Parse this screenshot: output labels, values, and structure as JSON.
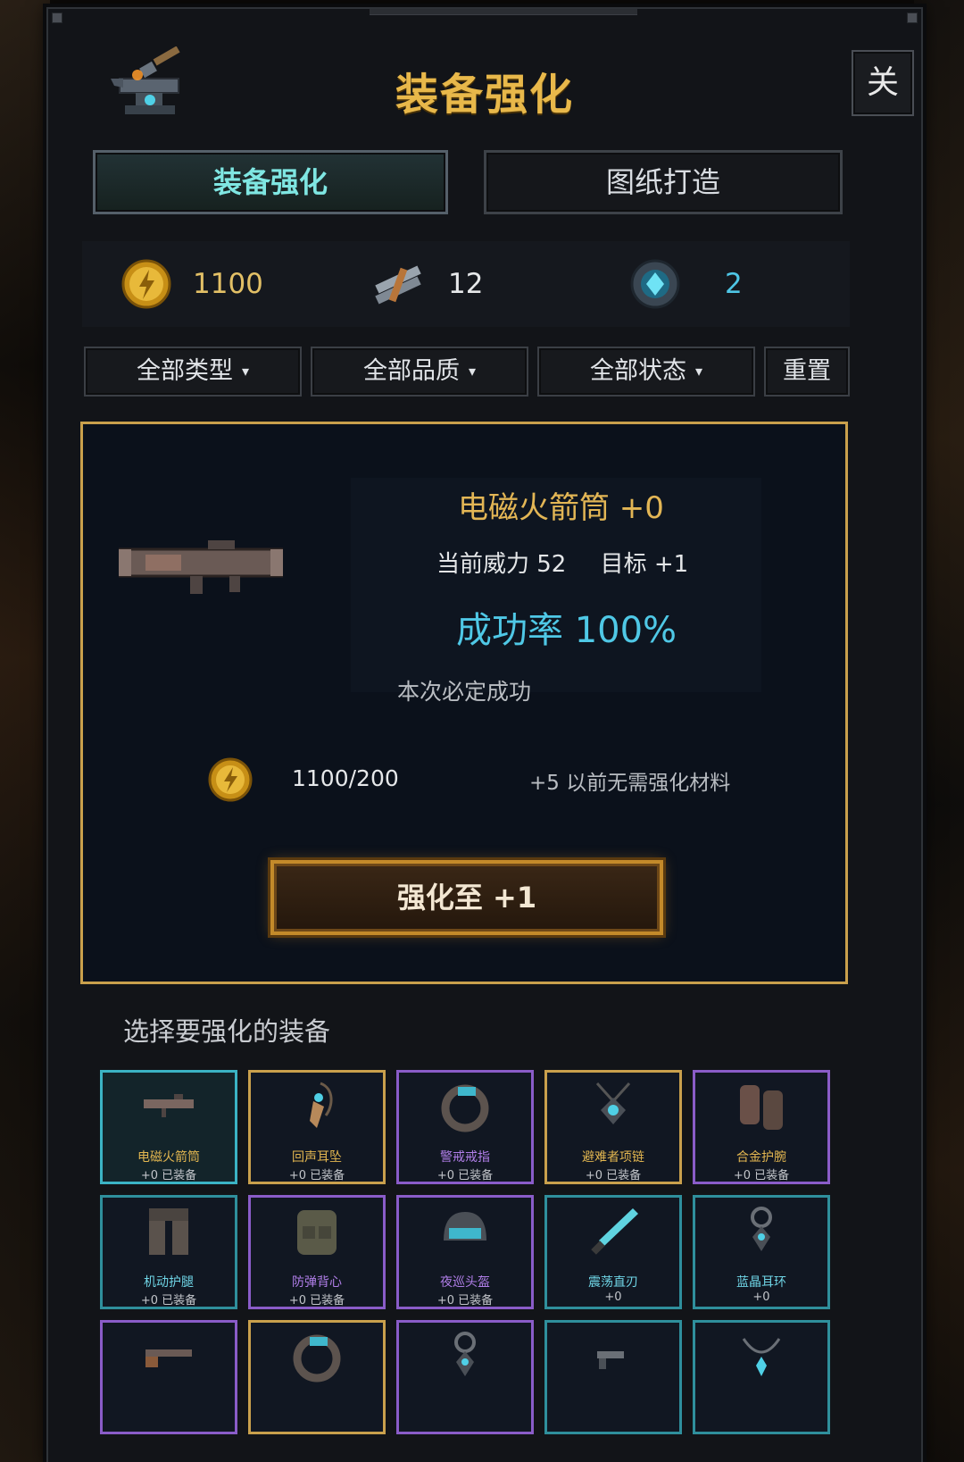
{
  "header": {
    "title": "装备强化",
    "close_label": "关"
  },
  "tabs": [
    {
      "label": "装备强化",
      "active": true
    },
    {
      "label": "图纸打造",
      "active": false
    }
  ],
  "resources": {
    "gold": "1100",
    "material": "12",
    "gem": "2"
  },
  "filters": {
    "type": "全部类型",
    "quality": "全部品质",
    "status": "全部状态",
    "reset": "重置",
    "caret": "▾"
  },
  "detail": {
    "name": "电磁火箭筒 +0",
    "power_label": "当前威力 52",
    "target_label": "目标 +1",
    "success_rate": "成功率 100%",
    "guarantee": "本次必定成功",
    "cost": "1100/200",
    "cost_note": "+5 以前无需强化材料",
    "upgrade_button": "强化至 +1"
  },
  "select_label": "选择要强化的装备",
  "equipment": [
    {
      "name": "电磁火箭筒",
      "status": "+0  已装备",
      "quality": "cyan-selected"
    },
    {
      "name": "回声耳坠",
      "status": "+0  已装备",
      "quality": "gold"
    },
    {
      "name": "警戒戒指",
      "status": "+0  已装备",
      "quality": "purple"
    },
    {
      "name": "避难者项链",
      "status": "+0  已装备",
      "quality": "gold"
    },
    {
      "name": "合金护腕",
      "status": "+0  已装备",
      "quality": "purple"
    },
    {
      "name": "机动护腿",
      "status": "+0  已装备",
      "quality": "teal"
    },
    {
      "name": "防弹背心",
      "status": "+0  已装备",
      "quality": "purple"
    },
    {
      "name": "夜巡头盔",
      "status": "+0  已装备",
      "quality": "purple"
    },
    {
      "name": "震荡直刃",
      "status": "+0",
      "quality": "teal"
    },
    {
      "name": "蓝晶耳环",
      "status": "+0",
      "quality": "teal"
    },
    {
      "name": "",
      "status": "",
      "quality": "purple"
    },
    {
      "name": "",
      "status": "",
      "quality": "gold"
    },
    {
      "name": "",
      "status": "",
      "quality": "purple"
    },
    {
      "name": "",
      "status": "",
      "quality": "teal"
    },
    {
      "name": "",
      "status": "",
      "quality": "teal"
    }
  ],
  "colors": {
    "accent_gold": "#e8b84a",
    "accent_cyan": "#4fc8e6",
    "panel_border": "#c9a04c",
    "quality_purple": "#8a5cc8",
    "quality_teal": "#2f8f9c"
  }
}
